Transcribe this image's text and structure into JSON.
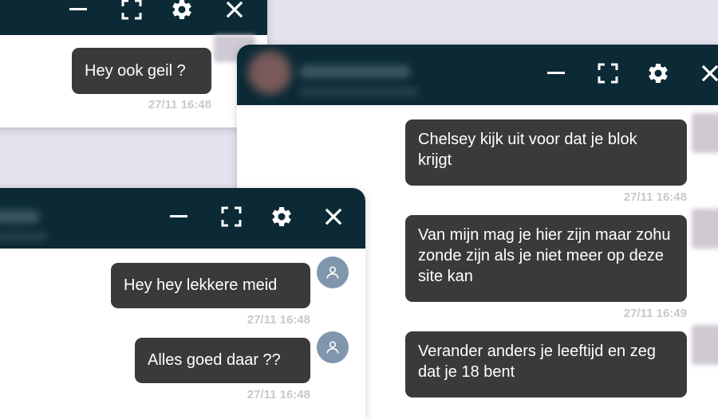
{
  "colors": {
    "header": "#0b2a35",
    "bubble": "#3a3a3a",
    "bubble_text": "#ffffff",
    "timestamp": "#c9c9c9",
    "avatar": "#7f96ad",
    "background": "#e4e2ee"
  },
  "icons": [
    "minimize-icon",
    "fullscreen-icon",
    "gear-icon",
    "close-icon",
    "user-icon"
  ],
  "chat_top_left": {
    "messages": [
      {
        "text": "Hey ook geil ?",
        "time": "27/11 16:48"
      }
    ]
  },
  "chat_right": {
    "messages": [
      {
        "text": "Chelsey kijk uit voor dat je blok krijgt",
        "time": "27/11 16:48"
      },
      {
        "text": "Van mijn mag je hier zijn maar zohu zonde zijn als je niet meer op deze site kan",
        "time": "27/11 16:49"
      },
      {
        "text": "Verander anders je leeftijd en zeg dat je 18 bent"
      }
    ]
  },
  "chat_bottom_left": {
    "messages": [
      {
        "text": "Hey hey lekkere meid",
        "time": "27/11 16:48"
      },
      {
        "text": "Alles goed daar ??",
        "time": "27/11 16:48"
      }
    ]
  }
}
